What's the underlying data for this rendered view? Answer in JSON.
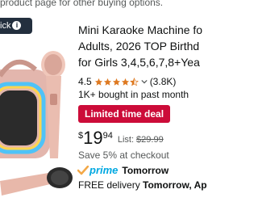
{
  "banner": {
    "text": "product page for other buying options."
  },
  "badge": {
    "label": "ick"
  },
  "product": {
    "title_lines": [
      "Mini Karaoke Machine fo",
      "Adults, 2026 TOP Birthd",
      "for Girls 3,4,5,6,7,8+Yea"
    ],
    "rating": "4.5",
    "stars_value": 4.5,
    "stars_max": 5,
    "rating_count": "(3.8K)",
    "bought": "1K+ bought in past month",
    "deal_label": "Limited time deal",
    "price": {
      "symbol": "$",
      "whole": "19",
      "fraction": "94",
      "list_label": "List:",
      "list_price": "$29.99"
    },
    "savings": "Save 5% at checkout",
    "prime": {
      "label": "prime",
      "day": "Tomorrow"
    },
    "delivery": {
      "prefix": "FREE delivery",
      "day": "Tomorrow, Ap"
    }
  },
  "colors": {
    "deal_red": "#cc0c39",
    "prime_blue": "#00a8e1",
    "star_orange": "#de7921",
    "badge_dark": "#232f3e"
  }
}
